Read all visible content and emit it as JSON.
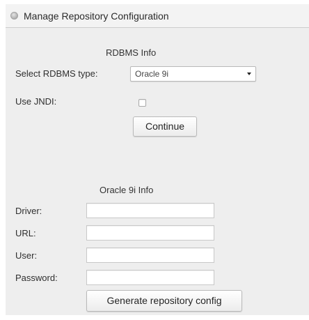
{
  "header": {
    "title": "Manage Repository Configuration",
    "icon": "circle-bullet-icon"
  },
  "rdbms_section": {
    "title": "RDBMS Info",
    "select_label": "Select RDBMS type:",
    "select_value": "Oracle 9i",
    "jndi_label": "Use JNDI:",
    "jndi_checked": false,
    "continue_label": "Continue"
  },
  "oracle_section": {
    "title": "Oracle 9i Info",
    "fields": [
      {
        "label": "Driver:",
        "value": ""
      },
      {
        "label": "URL:",
        "value": ""
      },
      {
        "label": "User:",
        "value": ""
      },
      {
        "label": "Password:",
        "value": ""
      }
    ],
    "generate_label": "Generate repository config"
  },
  "colors": {
    "panel_background": "#eeeeee",
    "header_background": "#f3f3f3",
    "input_background": "#ffffff"
  }
}
